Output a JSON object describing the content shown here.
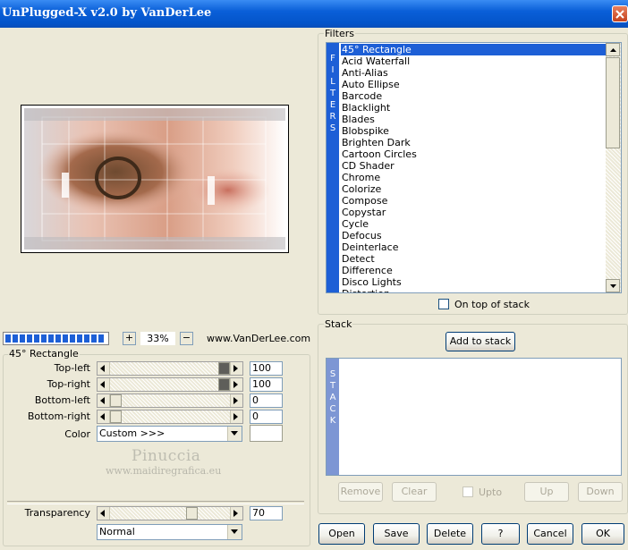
{
  "window": {
    "title": "UnPlugged-X v2.0 by VanDerLee"
  },
  "zoom": {
    "plus_label": "+",
    "value": "33%",
    "minus_label": "−",
    "site": "www.VanDerLee.com",
    "progress_fraction": 1.0
  },
  "params": {
    "group_label": "45° Rectangle",
    "rows": [
      {
        "label": "Top-left",
        "value": "100",
        "level": 1.0
      },
      {
        "label": "Top-right",
        "value": "100",
        "level": 1.0
      },
      {
        "label": "Bottom-left",
        "value": "0",
        "level": 0.0
      },
      {
        "label": "Bottom-right",
        "value": "0",
        "level": 0.0
      }
    ],
    "color_label": "Color",
    "color_value": "Custom >>>",
    "transparency_label": "Transparency",
    "transparency_value": "70",
    "transparency_level": 0.7,
    "blend_mode": "Normal"
  },
  "watermark": {
    "line1": "Pinuccia",
    "line2": "www.maidiregrafica.eu"
  },
  "filters": {
    "group_label": "Filters",
    "strip_letters": [
      "F",
      "I",
      "L",
      "T",
      "E",
      "R",
      "S"
    ],
    "items": [
      "45° Rectangle",
      "Acid Waterfall",
      "Anti-Alias",
      "Auto Ellipse",
      "Barcode",
      "Blacklight",
      "Blades",
      "Blobspike",
      "Brighten Dark",
      "Cartoon Circles",
      "CD Shader",
      "Chrome",
      "Colorize",
      "Compose",
      "Copystar",
      "Cycle",
      "Defocus",
      "Deinterlace",
      "Detect",
      "Difference",
      "Disco Lights",
      "Distortion"
    ],
    "selected_index": 0,
    "on_top_label": "On top of stack"
  },
  "stack": {
    "group_label": "Stack",
    "add_label": "Add to stack",
    "strip_letters": [
      "S",
      "T",
      "A",
      "C",
      "K"
    ],
    "remove_label": "Remove",
    "clear_label": "Clear",
    "upto_label": "Upto",
    "up_label": "Up",
    "down_label": "Down"
  },
  "footer": {
    "open": "Open",
    "save": "Save",
    "delete": "Delete",
    "help": "?",
    "cancel": "Cancel",
    "ok": "OK"
  },
  "colors": {
    "accent": "#1D5FD6",
    "face": "#ECE9D8",
    "titlebar": "#0A5FD8"
  }
}
